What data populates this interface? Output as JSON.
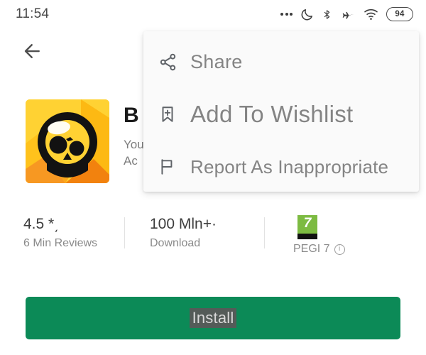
{
  "status_bar": {
    "time": "11:54",
    "battery_level": "94",
    "icons": [
      "more-dots-icon",
      "do-not-disturb-moon-icon",
      "bluetooth-icon",
      "airplane-mode-icon",
      "wifi-icon",
      "battery-icon"
    ]
  },
  "app_bar": {
    "back_icon": "back-arrow-icon"
  },
  "app": {
    "icon_name": "brawl-stars-app-icon",
    "title": "B",
    "developer": "You",
    "category": "Ac",
    "icon_colors": {
      "bg_light": "#FFD233",
      "bg_mid": "#FFB60A",
      "bg_dark": "#F79009",
      "skull": "#121212"
    }
  },
  "stats": [
    {
      "value": "4.5 *͵",
      "label": "6 Min Reviews",
      "name": "rating-stat"
    },
    {
      "value": "100 Mln+·",
      "label": "Download",
      "name": "downloads-stat"
    },
    {
      "value": "7",
      "label": "PEGI 7",
      "name": "content-rating-stat",
      "badge_color": "#7DBB42",
      "info_icon": "info-icon"
    }
  ],
  "install": {
    "label": "Install",
    "color": "#0C8A57",
    "label_highlight": "#545b58"
  },
  "context_menu": {
    "items": [
      {
        "label": "Share",
        "icon": "share-nodes-icon"
      },
      {
        "label": "Add To Wishlist",
        "icon": "bookmark-plus-icon"
      },
      {
        "label": "Report As Inappropriate",
        "icon": "flag-icon"
      }
    ]
  }
}
